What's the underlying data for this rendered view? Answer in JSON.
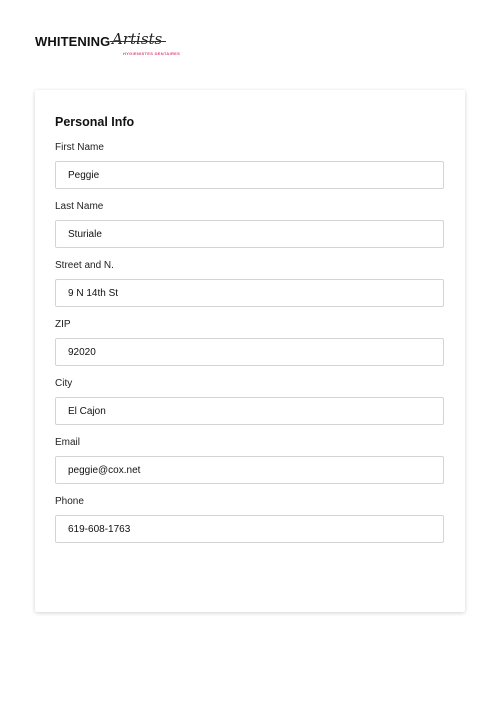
{
  "brand": {
    "name": "WHITENING",
    "script": "Artists",
    "tagline": "HYGIENISTES DENTAIRES"
  },
  "form": {
    "title": "Personal Info",
    "fields": [
      {
        "label": "First Name",
        "value": "Peggie"
      },
      {
        "label": "Last Name",
        "value": "Sturiale"
      },
      {
        "label": "Street and N.",
        "value": "9 N 14th St"
      },
      {
        "label": "ZIP",
        "value": "92020"
      },
      {
        "label": "City",
        "value": "El Cajon"
      },
      {
        "label": "Email",
        "value": "peggie@cox.net"
      },
      {
        "label": "Phone",
        "value": "619-608-1763"
      }
    ]
  },
  "colors": {
    "brand_pink": "#e0457b",
    "input_border": "#d4d4d4"
  }
}
